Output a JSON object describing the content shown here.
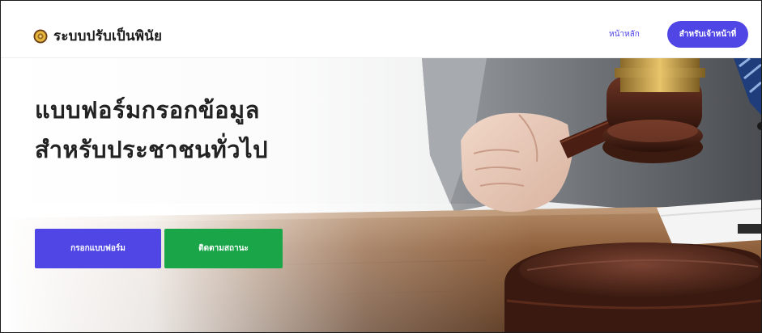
{
  "header": {
    "brand_title": "ระบบปรับเป็นพินัย",
    "brand_logo_icon": "emblem-seal-icon",
    "nav_home": "หน้าหลัก",
    "nav_officer": "สำหรับเจ้าหน้าที่"
  },
  "hero": {
    "heading_line1": "แบบฟอร์มกรอกข้อมูล",
    "heading_line2": "สำหรับประชาชนทั่วไป",
    "fill_form_button": "กรอกแบบฟอร์ม",
    "track_status_button": "ติดตามสถานะ",
    "image_subject": "gavel-icon"
  },
  "colors": {
    "accent": "#4f46e5",
    "success": "#1aa548",
    "text_dark": "#222222"
  }
}
